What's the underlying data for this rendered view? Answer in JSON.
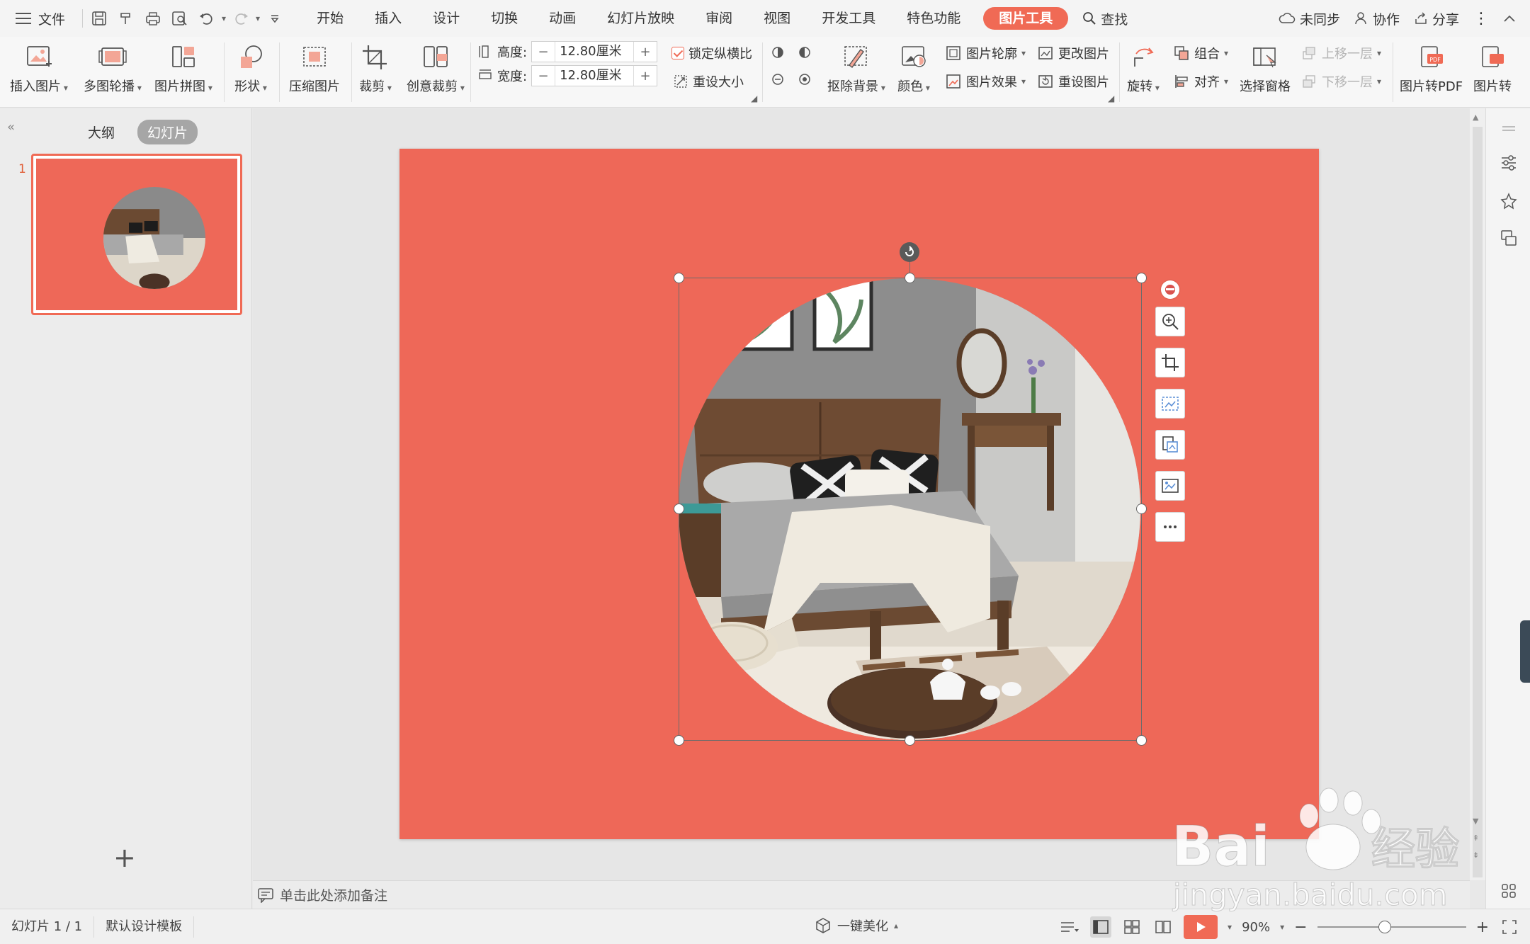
{
  "menubar": {
    "file_label": "文件",
    "tabs": [
      "开始",
      "插入",
      "设计",
      "切换",
      "动画",
      "幻灯片放映",
      "审阅",
      "视图",
      "开发工具",
      "特色功能",
      "图片工具"
    ],
    "active_tab": "图片工具",
    "search_label": "查找",
    "right": {
      "sync": "未同步",
      "collab": "协作",
      "share": "分享"
    }
  },
  "ribbon": {
    "insert_picture": "插入图片",
    "multi_carousel": "多图轮播",
    "picture_collage": "图片拼图",
    "shape": "形状",
    "compress": "压缩图片",
    "crop": "裁剪",
    "creative_crop": "创意裁剪",
    "height_label": "高度:",
    "width_label": "宽度:",
    "height_value": "12.80厘米",
    "width_value": "12.80厘米",
    "lock_ratio": "锁定纵横比",
    "reset_size": "重设大小",
    "remove_bg": "抠除背景",
    "color": "颜色",
    "picture_outline": "图片轮廓",
    "picture_effect": "图片效果",
    "change_picture": "更改图片",
    "reset_picture": "重设图片",
    "rotate": "旋转",
    "group": "组合",
    "align": "对齐",
    "selection_pane": "选择窗格",
    "bring_forward": "上移一层",
    "send_backward": "下移一层",
    "to_pdf": "图片转PDF",
    "to_more": "图片转"
  },
  "leftpane": {
    "tab_outline": "大纲",
    "tab_slides": "幻灯片",
    "slide_number": "1"
  },
  "notes_placeholder": "单击此处添加备注",
  "status": {
    "slide_info": "幻灯片 1 / 1",
    "template": "默认设计模板",
    "beautify": "一键美化",
    "zoom": "90%"
  },
  "watermark": {
    "brand": "Bai",
    "brand_cn": "经验",
    "url": "jingyan.baidu.com"
  },
  "colors": {
    "accent": "#f06a55",
    "slide_bg": "#ee6858"
  }
}
